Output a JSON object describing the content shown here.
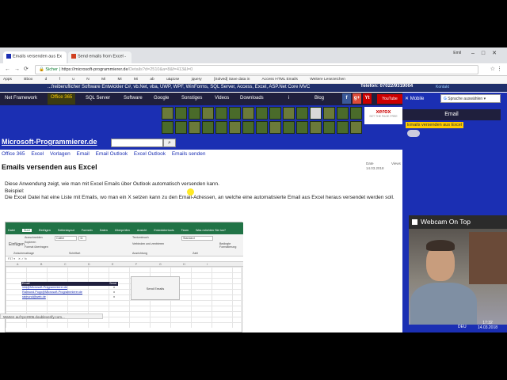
{
  "browser": {
    "tabs": [
      {
        "label": "Emails versenden aus Ex",
        "active": true,
        "favicon_color": "#1b2fb3"
      },
      {
        "label": "Send emails from Excel -",
        "active": false,
        "favicon_color": "#d04020"
      }
    ],
    "window_user": "Emil",
    "url_secure": "Sicher",
    "url_host": "https://microsoft-programmierer.de",
    "url_path": "/Details?d=2510&a=8&f=413&l=0",
    "bookmarks": [
      "Apps",
      "Bbox",
      "d",
      "f",
      "u",
      "N",
      "Mi",
      "Mi",
      "Mi",
      "ab",
      "u&p1se",
      "jquery",
      "[Solved] Save data in",
      "Access HTML Emails",
      "Weitere Lesezeichen"
    ]
  },
  "site": {
    "tagline": "...freiberuflicher Software Entwickler C#, vb.Net, vba, UWP, WPF, WinForms, SQL Server, Access, Excel, ASP.Net Core MVC",
    "phone": "Telefon: 07022/9319004",
    "contact": "Kontakt",
    "nav": [
      "Net Framework",
      "Office 365",
      "SQL Server",
      "Software",
      "Google",
      "Sonstiges",
      "Videos",
      "Downloads",
      "i",
      "Blog"
    ],
    "nav_active": "Office 365",
    "social": [
      "f",
      "g+",
      "Yt"
    ],
    "youtube_label": "YouTube",
    "mobile_label": "Mobile",
    "language_select": "Sprache auswählen",
    "xerox_logo": "xerox",
    "xerox_sub": "SET THE PAGE FREE",
    "brand": "Microsoft-Programmierer.de",
    "search_icon": "magnifier-icon",
    "breadcrumb": [
      "Office 365",
      "Excel",
      "Vorlagen",
      "Email",
      "Email Outlook",
      "Excel Outlook",
      "Emails senden"
    ],
    "title": "Emails versenden aus Excel",
    "meta_date_label": "Date",
    "meta_date": "14.03.2018",
    "meta_views_label": "Views",
    "sidebar_heading": "Email",
    "sidebar_link": "Emails versenden aus Excel",
    "article": [
      "Diese Anwendung zeigt, wie man mit Excel Emails über Outlook automatisch versenden kann.",
      "Beispiel:",
      "Die Excel Datei hat eine Liste mit Emails, wo man ein X setzen kann zu den Email-Adressen, an welche eine automatisierte Email aus Excel heraus versendet werden soll."
    ]
  },
  "excel": {
    "ribbon_tabs": [
      "Datei",
      "Start",
      "Einfügen",
      "Seitenlayout",
      "Formeln",
      "Daten",
      "Überprüfen",
      "Ansicht",
      "Entwicklertools",
      "Team",
      "Was möchten Sie tun?"
    ],
    "active_tab": "Start",
    "ribbon": {
      "cut": "Ausschneiden",
      "copy": "Kopieren",
      "format": "Format übertragen",
      "paste": "Einfügen",
      "clipboard": "Zwischenablage",
      "font": "Calibri",
      "font_size": "11",
      "font_group": "Schriftart",
      "wrap": "Textumbruch",
      "merge": "Verbinden und zentrieren",
      "align_group": "Ausrichtung",
      "number_format": "Standard",
      "number_group": "Zahl",
      "conditional": "Bedingte Formatierung"
    },
    "cell_ref": "F37",
    "columns": [
      "A",
      "B",
      "C",
      "D",
      "E",
      "F",
      "G",
      "H",
      "I"
    ],
    "table_header": "Email",
    "table_header2": "Send",
    "rows": [
      {
        "email": "info@Microsoft-Programmierer.de",
        "send": "x"
      },
      {
        "email": "Raimund.Popp@Microsoft-Programmierer.de",
        "send": "x"
      },
      {
        "email": "raimund@web.de",
        "send": "x"
      }
    ],
    "send_button": "Send Emails",
    "status": "Warten auf tpc2006.doubleverify.com..."
  },
  "webcam": {
    "title": "Webcam On Top"
  },
  "taskbar": {
    "language": "DEU",
    "time": "17:32",
    "date": "14.03.2018"
  }
}
